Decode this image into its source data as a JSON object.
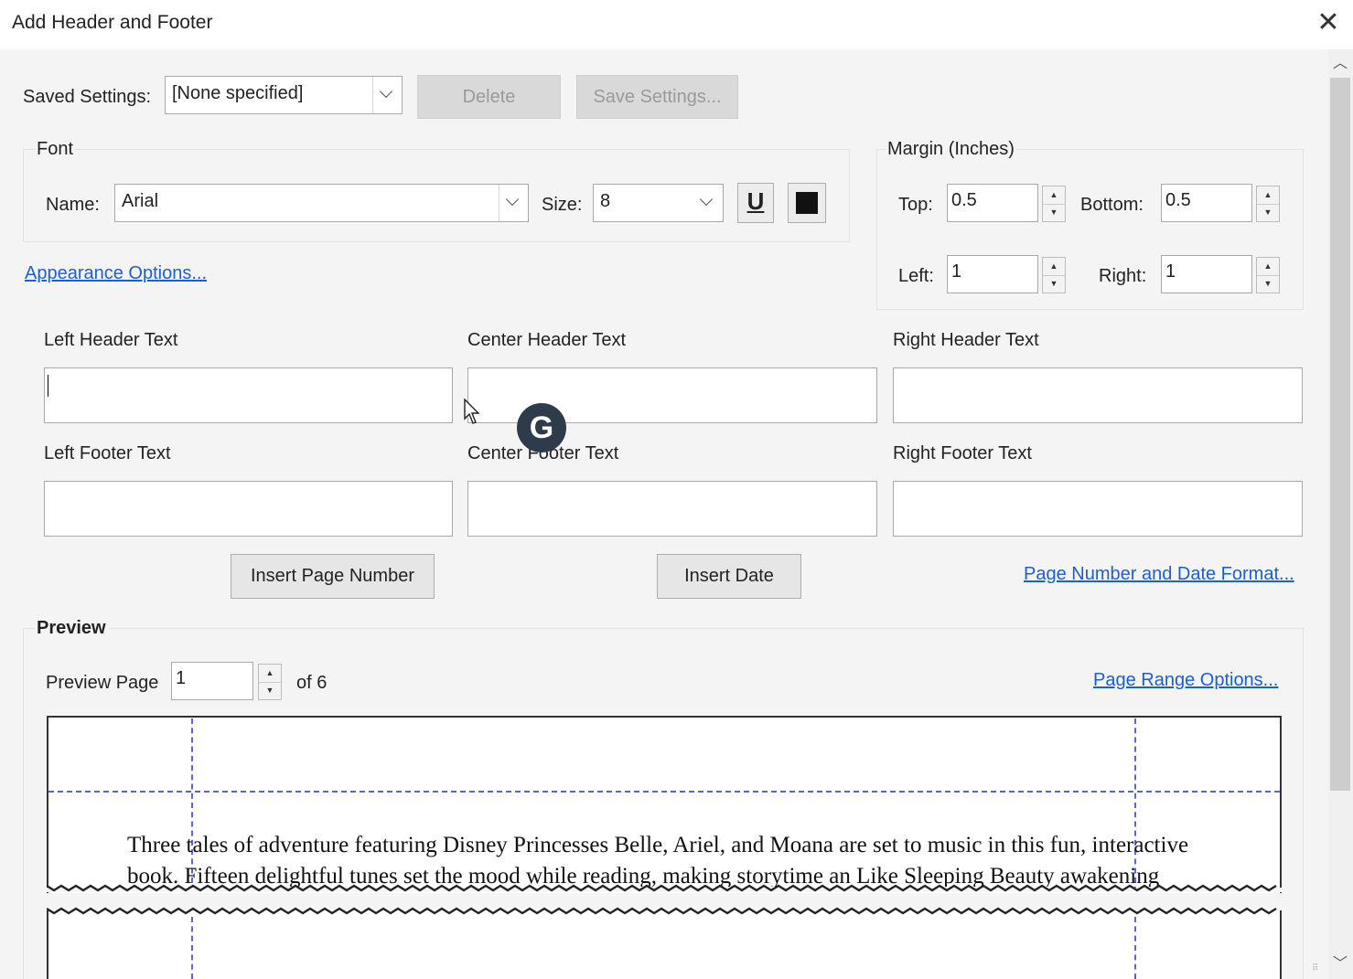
{
  "dialog": {
    "title": "Add Header and Footer",
    "close_glyph": "✕"
  },
  "saved_settings": {
    "label": "Saved Settings:",
    "value": "[None specified]",
    "delete_label": "Delete",
    "save_label": "Save Settings..."
  },
  "font": {
    "group_label": "Font",
    "name_label": "Name:",
    "name_value": "Arial",
    "size_label": "Size:",
    "size_value": "8",
    "underline_glyph": "U",
    "color": "#111111"
  },
  "margin": {
    "group_label": "Margin (Inches)",
    "top_label": "Top:",
    "top_value": "0.5",
    "bottom_label": "Bottom:",
    "bottom_value": "0.5",
    "left_label": "Left:",
    "left_value": "1",
    "right_label": "Right:",
    "right_value": "1"
  },
  "appearance_link": "Appearance Options...",
  "text_fields": {
    "left_header_label": "Left Header Text",
    "center_header_label": "Center Header Text",
    "right_header_label": "Right Header Text",
    "left_footer_label": "Left Footer Text",
    "center_footer_label": "Center Footer Text",
    "right_footer_label": "Right Footer Text",
    "left_header_value": "",
    "center_header_value": "",
    "right_header_value": "",
    "left_footer_value": "",
    "center_footer_value": "",
    "right_footer_value": ""
  },
  "actions": {
    "insert_page_number": "Insert Page Number",
    "insert_date": "Insert Date",
    "format_link": "Page Number and Date Format..."
  },
  "preview": {
    "group_label": "Preview",
    "page_label": "Preview Page",
    "page_value": "1",
    "of_label": "of 6",
    "range_link": "Page Range Options...",
    "line1": "Three tales of adventure featuring Disney Princesses Belle, Ariel, and Moana are set to music in this fun, interactive",
    "line2": "book. Fifteen delightful tunes set the mood while reading, making storytime an Like Sleeping Beauty awakening"
  },
  "overlay": {
    "grammarly_glyph": "G"
  },
  "icons": {
    "spin_up": "▲",
    "spin_down": "▼",
    "scroll_up": "︿",
    "scroll_down": "﹀",
    "grip": "⠿"
  }
}
